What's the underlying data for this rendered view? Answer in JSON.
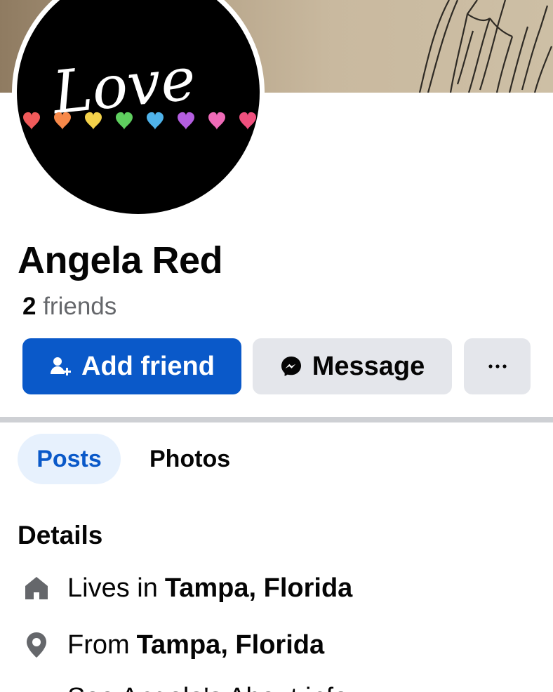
{
  "profile": {
    "name": "Angela Red",
    "friends_count": "2",
    "friends_label": "friends",
    "avatar_text": "Love"
  },
  "actions": {
    "add_friend_label": "Add friend",
    "message_label": "Message",
    "more_icon": "more-dots-icon"
  },
  "tabs": [
    {
      "label": "Posts",
      "active": true
    },
    {
      "label": "Photos",
      "active": false
    }
  ],
  "details": {
    "title": "Details",
    "items": [
      {
        "icon": "home-icon",
        "prefix": "Lives in",
        "value": "Tampa, Florida"
      },
      {
        "icon": "location-pin-icon",
        "prefix": "From",
        "value": "Tampa, Florida"
      }
    ],
    "partial_line": "See Angela's About info"
  },
  "colors": {
    "primary": "#0a59c9",
    "secondary_button": "#e4e6eb",
    "active_tab_bg": "#e7f1fd",
    "muted_text": "#65676b",
    "divider": "#ced0d4"
  }
}
